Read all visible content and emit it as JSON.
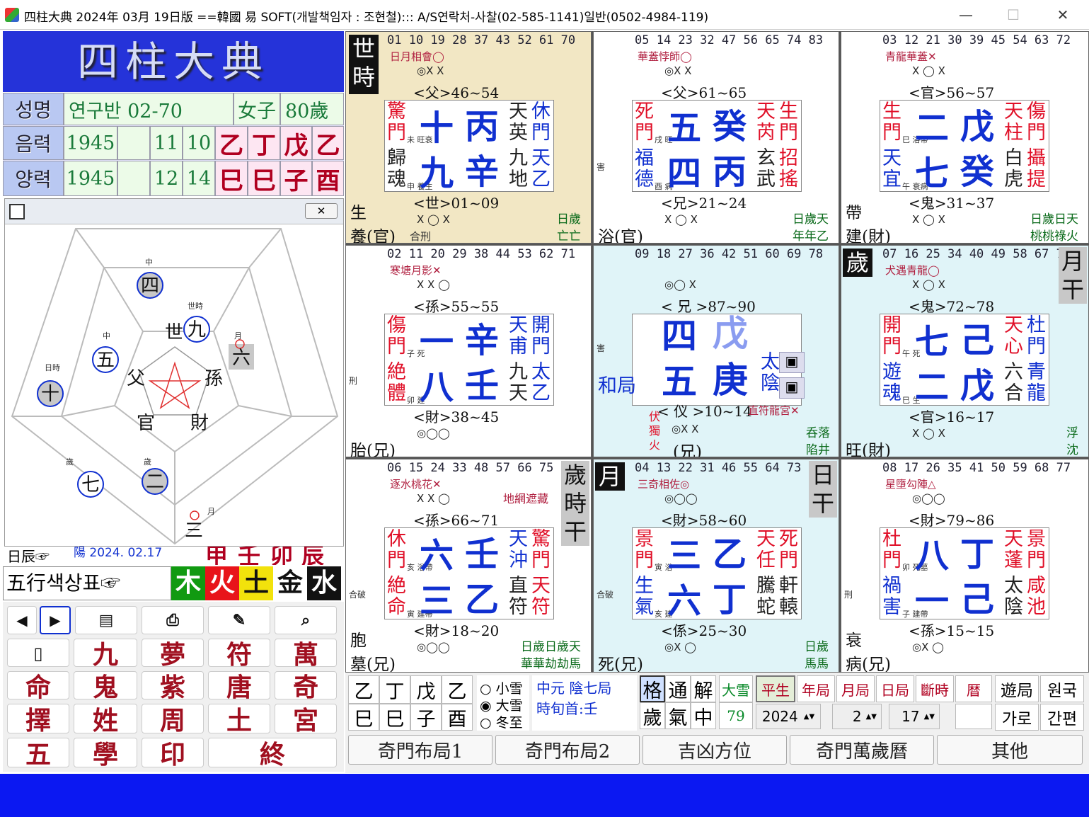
{
  "window": {
    "title": "四柱大典 2024年 03月 19日版 ==韓國 易 SOFT(개발책임자 : 조현철)::: A/S연락처-사찰(02-585-1141)일반(0502-4984-119)",
    "minimize": "—",
    "maximize": "☐",
    "close": "✕"
  },
  "logo": "四柱大典",
  "info": {
    "name_label": "성명",
    "name_value": "연구반 02-70",
    "gender": "女子",
    "age": "80歲",
    "lunar_label": "음력",
    "lunar_year": "1945",
    "lunar_month": "11",
    "lunar_day": "10",
    "solar_label": "양력",
    "solar_year": "1945",
    "solar_month": "12",
    "solar_day": "14",
    "stems": [
      "乙",
      "丁",
      "戊",
      "乙"
    ],
    "branches": [
      "巳",
      "巳",
      "子",
      "酉"
    ]
  },
  "pentagon": {
    "center": [
      "世",
      "孫",
      "財",
      "官",
      "父"
    ],
    "nodes": [
      {
        "label": "中",
        "char": "四"
      },
      {
        "label": "世時",
        "char": "九"
      },
      {
        "label": "月",
        "char": "六"
      },
      {
        "label": "中",
        "char": "五"
      },
      {
        "label": "日時",
        "char": "十"
      },
      {
        "label": "歲",
        "char": "七"
      },
      {
        "label": "歲",
        "char": "二"
      },
      {
        "label": "月",
        "char": "三"
      }
    ],
    "close": "✕"
  },
  "strip": {
    "t1": "日辰☞",
    "t2": "陽 2024. 02.17",
    "gz": [
      "甲",
      "壬",
      "卯",
      "辰"
    ]
  },
  "colorbar": {
    "label": "五行색상표☞",
    "elements": [
      "木",
      "火",
      "土",
      "金",
      "水"
    ]
  },
  "buttons": [
    "九",
    "夢",
    "符",
    "萬",
    "命",
    "鬼",
    "紫",
    "唐",
    "奇",
    "擇",
    "姓",
    "周",
    "土",
    "宮",
    "五",
    "學",
    "印",
    "終"
  ],
  "palaces": [
    {
      "nums": "01 10 19 28 37 43 52 61 70",
      "star": "日月相會◯",
      "m1": "◎X X",
      "rel1": "<父>46~54",
      "tl": [
        "驚",
        "門"
      ],
      "tlsub": "未  旺衰",
      "bl": [
        "歸",
        "魂"
      ],
      "blsub": "申  養生",
      "tn": "十",
      "ts": "丙",
      "bn": "九",
      "bs": "辛",
      "rt": [
        "天",
        "英"
      ],
      "rtb": [
        "休",
        "門"
      ],
      "rb": [
        "九",
        "地"
      ],
      "rbb": [
        "天",
        "乙"
      ],
      "rel2": "<世>01~09",
      "m2": "X ◯ X",
      "c1": "生",
      "c2": "養(官)",
      "c3": "合刑",
      "g1": "日歲",
      "g2": "亡亡",
      "badge": "世\n時"
    },
    {
      "nums": "05 14 23 32 47 56 65 74 83",
      "star": "華蓋悖師◯",
      "m1": "◎X X",
      "rel1": "<父>61~65",
      "tl": [
        "死",
        "門"
      ],
      "tlsub": "戌  旺",
      "bl": [
        "福",
        "德"
      ],
      "blsub": "酉  病",
      "tn": "五",
      "ts": "癸",
      "bn": "四",
      "bs": "丙",
      "rt": [
        "天",
        "芮"
      ],
      "rtb": [
        "生",
        "門"
      ],
      "rb": [
        "玄",
        "武"
      ],
      "rbb": [
        "招",
        "搖"
      ],
      "rel2": "<兄>21~24",
      "m2": "X ◯ X",
      "c1": "",
      "c2": "浴(官)",
      "c3": "害",
      "g1": "日歲天",
      "g2": "年年乙"
    },
    {
      "nums": "03 12 21 30 39 45 54 63 72",
      "star": "青龍華蓋✕",
      "m1": "X ◯ X",
      "rel1": "<官>56~57",
      "tl": [
        "生",
        "門"
      ],
      "tlsub": "巳  浴帶",
      "bl": [
        "天",
        "宜"
      ],
      "blsub": "午  衰病",
      "tn": "二",
      "ts": "戊",
      "bn": "七",
      "bs": "癸",
      "rt": [
        "天",
        "柱"
      ],
      "rtb": [
        "傷",
        "門"
      ],
      "rb": [
        "白",
        "虎"
      ],
      "rbb": [
        "攝",
        "提"
      ],
      "rel2": "<鬼>31~37",
      "m2": "X ◯ X",
      "c1": "帶",
      "c2": "建(財)",
      "c3": "",
      "g1": "日歲日天",
      "g2": "桃桃祿火"
    },
    {
      "nums": "02 11 20 29 38 44 53 62 71",
      "star": "寒塘月影✕",
      "m1": "X X ◯",
      "rel1": "<孫>55~55",
      "tl": [
        "傷",
        "門"
      ],
      "tlsub": "子  死",
      "bl": [
        "絶",
        "體"
      ],
      "blsub": "卯  建",
      "tn": "一",
      "ts": "辛",
      "bn": "八",
      "bs": "壬",
      "rt": [
        "天",
        "甫"
      ],
      "rtb": [
        "開",
        "門"
      ],
      "rb": [
        "九",
        "天"
      ],
      "rbb": [
        "太",
        "乙"
      ],
      "rel2": "<財>38~45",
      "m2": "◎◯◯",
      "c1": "",
      "c2": "胎(兄)",
      "c3": "刑",
      "g1": "",
      "g2": ""
    },
    {
      "nums": "09 18 27 36 42 51 60 69 78",
      "star": "",
      "m1": "◎◯ X",
      "rel1": "< 兄 >87~90",
      "tn": "四",
      "ts": "戊",
      "bn": "五",
      "bs": "庚",
      "rel2": "< 仪 >10~14",
      "star2": "直符龍宮✕",
      "m2": "◎X X",
      "c2": "(兄)",
      "c3": "害",
      "mid": "和局",
      "fire": [
        "伏",
        "獨",
        "火"
      ],
      "g1": "呑落",
      "g2": "陷井",
      "taiyin": [
        "太",
        "陰"
      ]
    },
    {
      "nums": "07 16 25 34 40 49 58 67 76",
      "star": "犬遇青龍◯",
      "m1": "X ◯ X",
      "rel1": "<鬼>72~78",
      "tl": [
        "開",
        "門"
      ],
      "tlsub": "午  死",
      "bl": [
        "遊",
        "魂"
      ],
      "blsub": "巳  生",
      "tn": "七",
      "ts": "己",
      "bn": "二",
      "bs": "戊",
      "rt": [
        "天",
        "心"
      ],
      "rtb": [
        "杜",
        "門"
      ],
      "rb": [
        "六",
        "合"
      ],
      "rbb": [
        "青",
        "龍"
      ],
      "rel2": "<官>16~17",
      "m2": "X ◯ X",
      "c2": "旺(財)",
      "g1": "浮",
      "g2": "沈",
      "badge": "歲",
      "badgeg": "月\n干"
    },
    {
      "nums": "06 15 24 33 48 57 66 75 84",
      "star": "逐水桃花✕",
      "star3": "地網遮藏",
      "m1": "X X ◯",
      "rel1": "<孫>66~71",
      "tl": [
        "休",
        "門"
      ],
      "tlsub": "亥  浴帶",
      "bl": [
        "絶",
        "命"
      ],
      "blsub": "寅  建帶",
      "tn": "六",
      "ts": "壬",
      "bn": "三",
      "bs": "乙",
      "rt": [
        "天",
        "沖"
      ],
      "rtb": [
        "驚",
        "門"
      ],
      "rb": [
        "直",
        "符"
      ],
      "rbb": [
        "天",
        "符"
      ],
      "rel2": "<財>18~20",
      "m2": "◎◯◯",
      "c1": "胞",
      "c2": "墓(兄)",
      "c3": "合破",
      "g1": "日歲日歲天",
      "g2": "華華劫劫馬",
      "badgeg": "歲\n時\n干"
    },
    {
      "nums": "04 13 22 31 46 55 64 73 82",
      "star": "三奇相佐◎",
      "m1": "◎◯◯",
      "rel1": "<財>58~60",
      "tl": [
        "景",
        "門"
      ],
      "tlsub": "寅  浴",
      "bl": [
        "生",
        "氣"
      ],
      "blsub": "亥  建",
      "tn": "三",
      "ts": "乙",
      "bn": "六",
      "bs": "丁",
      "rt": [
        "天",
        "任"
      ],
      "rtb": [
        "死",
        "門"
      ],
      "rb": [
        "騰",
        "蛇"
      ],
      "rbb": [
        "軒",
        "轅"
      ],
      "rel2": "<係>25~30",
      "m2": "◎X ◯",
      "c2": "死(兄)",
      "c3": "合破",
      "g1": "日歲",
      "g2": "馬馬",
      "badge": "月",
      "badgeg": "日\n干"
    },
    {
      "nums": "08 17 26 35 41 50 59 68 77",
      "star": "星墮勾陣△",
      "m1": "◎◯◯",
      "rel1": "<財>79~86",
      "tl": [
        "杜",
        "門"
      ],
      "tlsub": "卯  死墓",
      "bl": [
        "禍",
        "害"
      ],
      "blsub": "子  建帶",
      "tn": "八",
      "ts": "丁",
      "bn": "一",
      "bs": "己",
      "rt": [
        "天",
        "蓬"
      ],
      "rtb": [
        "景",
        "門"
      ],
      "rb": [
        "太",
        "陰"
      ],
      "rbb": [
        "咸",
        "池"
      ],
      "rel2": "<孫>15~15",
      "m2": "◎X ◯",
      "c1": "衰",
      "c2": "病(兄)",
      "c3": "刑",
      "g1": "",
      "g2": ""
    }
  ],
  "bottom": {
    "stems": [
      "乙",
      "丁",
      "戊",
      "乙"
    ],
    "branches": [
      "巳",
      "巳",
      "子",
      "酉"
    ],
    "radios": [
      "小雪",
      "大雪",
      "冬至"
    ],
    "radio_sel": "大雪",
    "ju1": "中元  陰七局",
    "ju2": "時旬首:壬",
    "b1": [
      "格",
      "通",
      "解"
    ],
    "b2": [
      "歲",
      "氣",
      "中"
    ],
    "dae": "大雪",
    "dae_num": "79",
    "tabs": [
      "平生",
      "年局",
      "月局",
      "日局",
      "斷時",
      "暦"
    ],
    "year": "2024",
    "month": "2",
    "day": "17",
    "r1": "遊局",
    "r2": "원국",
    "r3": "가로",
    "r4": "간편",
    "main_tabs": [
      "奇門布局1",
      "奇門布局2",
      "吉凶方位",
      "奇門萬歲曆",
      "其他"
    ]
  }
}
